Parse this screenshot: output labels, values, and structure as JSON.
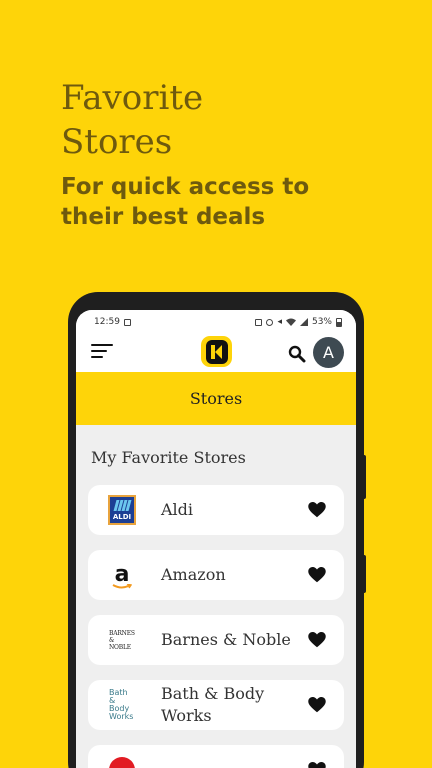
{
  "promo": {
    "title": "Favorite Stores",
    "subtitle": "For quick access to their best deals"
  },
  "status_bar": {
    "time": "12:59",
    "battery": "53%"
  },
  "app_bar": {
    "logo_letter": "K",
    "avatar_initial": "A"
  },
  "page": {
    "title": "Stores",
    "section_title": "My Favorite Stores"
  },
  "stores": [
    {
      "name": "Aldi",
      "logo": "aldi-logo",
      "logo_text": "ALDI"
    },
    {
      "name": "Amazon",
      "logo": "amazon-logo",
      "logo_text": "a"
    },
    {
      "name": "Barnes & Noble",
      "logo": "barnes-noble-logo",
      "logo_text": "BARNES & NOBLE"
    },
    {
      "name": "Bath & Body Works",
      "logo": "bath-body-works-logo",
      "logo_text": "Bath & Body Works"
    },
    {
      "name": "",
      "logo": "partial-store-logo"
    }
  ],
  "colors": {
    "background": "#FED409",
    "promo_text": "#6E5A0E",
    "avatar": "#3E4A52"
  }
}
